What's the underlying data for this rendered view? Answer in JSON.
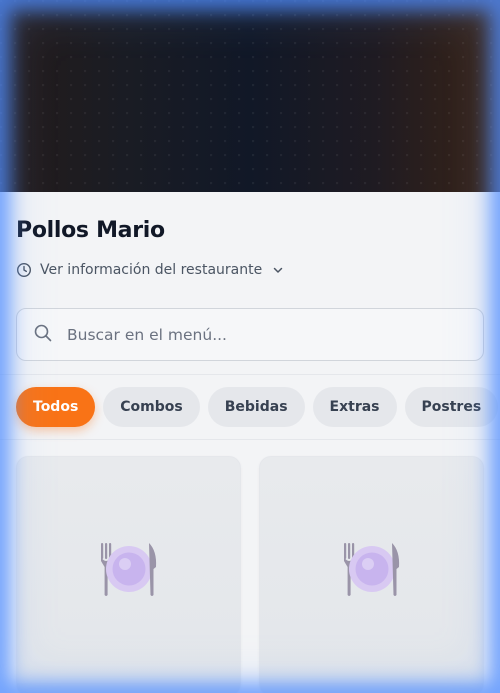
{
  "restaurant": {
    "name": "Pollos Mario",
    "info_link": "Ver información del restaurante"
  },
  "search": {
    "placeholder": "Buscar en el menú..."
  },
  "categories": {
    "active": "Todos",
    "items": [
      "Todos",
      "Combos",
      "Bebidas",
      "Extras",
      "Postres"
    ]
  },
  "menu": {
    "items": [
      {
        "image_icon": "plate-with-cutlery-icon"
      },
      {
        "image_icon": "plate-with-cutlery-icon"
      }
    ]
  },
  "colors": {
    "accent": "#f97316",
    "title": "#111827",
    "chip_bg": "#e5e7eb",
    "chip_text": "#374151"
  }
}
